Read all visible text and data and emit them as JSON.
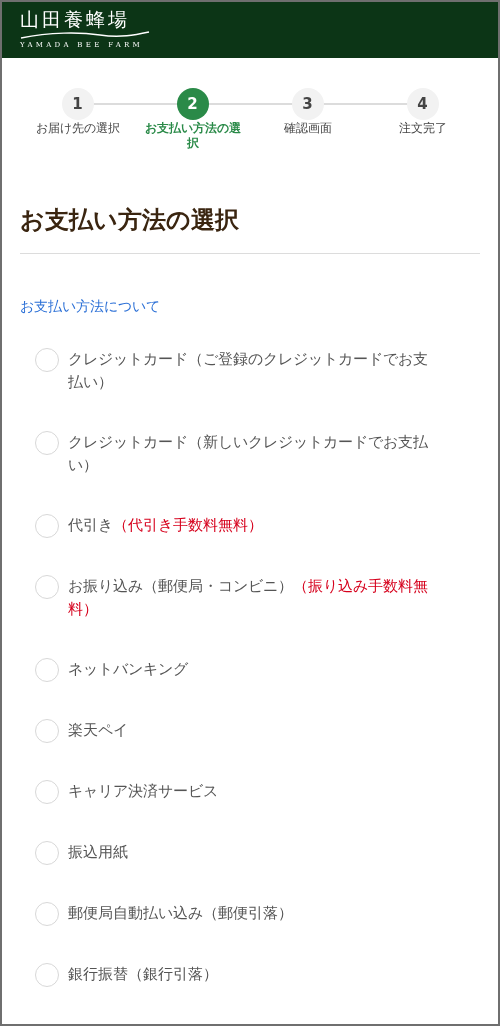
{
  "header": {
    "logo_title": "山田養蜂場",
    "logo_subtitle": "YAMADA BEE FARM"
  },
  "steps": [
    {
      "number": "1",
      "label": "お届け先の選択",
      "selected": false
    },
    {
      "number": "2",
      "label": "お支払い方法の選択",
      "selected": true
    },
    {
      "number": "3",
      "label": "確認画面",
      "selected": false
    },
    {
      "number": "4",
      "label": "注文完了",
      "selected": false
    }
  ],
  "page_title": "お支払い方法の選択",
  "info_link": "お支払い方法について",
  "payment_options": [
    {
      "label": "クレジットカード（ご登録のクレジットカードでお支払い）",
      "selected": false
    },
    {
      "label": "クレジットカード（新しいクレジットカードでお支払い）",
      "selected": false
    },
    {
      "label": "代引き",
      "note": "（代引き手数料無料）",
      "selected": false
    },
    {
      "label": "お振り込み（郵便局・コンビニ）",
      "note": "（振り込み手数料無料）",
      "selected": false
    },
    {
      "label": "ネットバンキング",
      "selected": false
    },
    {
      "label": "楽天ペイ",
      "selected": false
    },
    {
      "label": "キャリア決済サービス",
      "selected": false
    },
    {
      "label": "振込用紙",
      "selected": false
    },
    {
      "label": "郵便局自動払い込み（郵便引落）",
      "selected": false
    },
    {
      "label": "銀行振替（銀行引落）",
      "selected": false
    }
  ]
}
